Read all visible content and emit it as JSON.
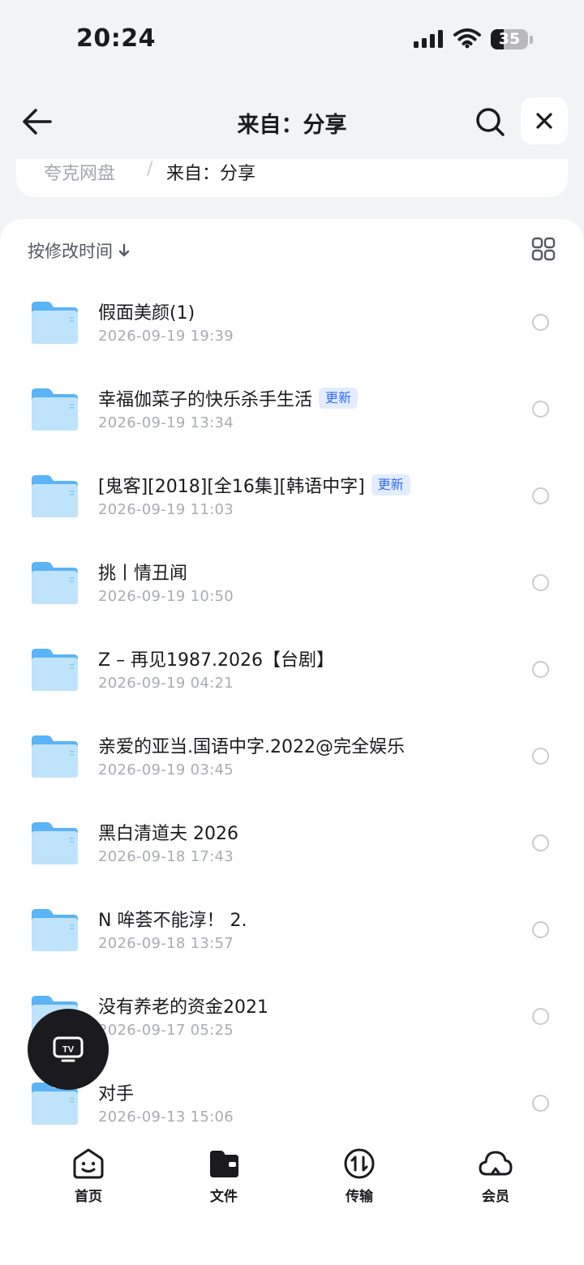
{
  "status_bar": {
    "time": "20:24",
    "battery": "35"
  },
  "nav": {
    "title": "来自：分享"
  },
  "breadcrumb": {
    "root": "夸克网盘",
    "separator": "/",
    "current": "来自：分享"
  },
  "sort": {
    "label": "按修改时间"
  },
  "files": [
    {
      "name": "假面美颜(1)",
      "date": "2026-09-19 19:39",
      "badge": ""
    },
    {
      "name": "幸福伽菜子的快乐杀手生活",
      "date": "2026-09-19 13:34",
      "badge": "更新"
    },
    {
      "name": "[鬼客][2018][全16集][韩语中字]",
      "date": "2026-09-19 11:03",
      "badge": "更新"
    },
    {
      "name": "挑丨情丑闻",
      "date": "2026-09-19 10:50",
      "badge": ""
    },
    {
      "name": "Z – 再见1987.2026【台剧】",
      "date": "2026-09-19 04:21",
      "badge": ""
    },
    {
      "name": "亲爱的亚当.国语中字.2022@完全娱乐",
      "date": "2026-09-19 03:45",
      "badge": ""
    },
    {
      "name": "黑白清道夫 2026",
      "date": "2026-09-18 17:43",
      "badge": ""
    },
    {
      "name": "N 哞荟不能淳！ 2.",
      "date": "2026-09-18 13:57",
      "badge": ""
    },
    {
      "name": "没有养老的资金2021",
      "date": "2026-09-17 05:25",
      "badge": ""
    },
    {
      "name": "对手",
      "date": "2026-09-13 15:06",
      "badge": ""
    }
  ],
  "tabs": [
    {
      "label": "首页",
      "icon": "smiley-home-icon"
    },
    {
      "label": "文件",
      "icon": "folder-wallet-icon"
    },
    {
      "label": "传输",
      "icon": "transfer-arrows-icon"
    },
    {
      "label": "会员",
      "icon": "cloud-icon"
    }
  ],
  "fab": {
    "icon": "tv-icon"
  },
  "colors": {
    "accent": "#2f6bff",
    "folder": "#5ab4f5",
    "fab_bg": "#1b1b1f"
  }
}
